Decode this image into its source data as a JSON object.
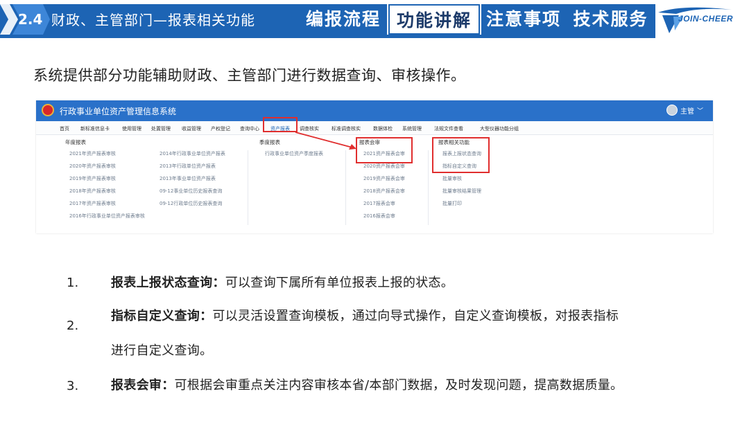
{
  "header": {
    "section_number": "2.4",
    "section_title": "财政、主管部门—报表相关功能",
    "tabs": [
      {
        "label": "编报流程",
        "active": false
      },
      {
        "label": "功能讲解",
        "active": true
      },
      {
        "label": "注意事项",
        "active": false
      },
      {
        "label": "技术服务",
        "active": false
      }
    ],
    "logo_text": "JOIN-CHEER",
    "brand_color": "#1d64b4"
  },
  "intro": "系统提供部分功能辅助财政、主管部门进行数据查询、审核操作。",
  "screenshot": {
    "system_title": "行政事业单位资产管理信息系统",
    "user_label": "主管",
    "user_chevron": "﹀",
    "menu_items": [
      "首页",
      "新标准信息卡",
      "使用管理",
      "处置管理",
      "收益管理",
      "产权登记",
      "查询中心",
      "资产报表",
      "调查核实",
      "标准调查核实",
      "数据体检",
      "系统管理",
      "法规文件查看",
      "大型仪器功能分组"
    ],
    "selected_menu": "资产报表",
    "columns": [
      {
        "heading": "年度报表",
        "items": [
          "2021年资产报表审核",
          "2020年资产报表审核",
          "2019年资产报表审核",
          "2018年资产报表审核",
          "2017年资产报表审核",
          "2016年行政事业单位资产报表审核"
        ]
      },
      {
        "heading": "",
        "items": [
          "2014年行政事业单位资产报表",
          "2013年行政单位资产报表",
          "2013年事业单位资产报表",
          "09-12事业单位历史报表查询",
          "09-12行政单位历史报表查询"
        ]
      },
      {
        "heading": "季度报表",
        "items": [
          "行政事业单位资产季度报表"
        ]
      },
      {
        "heading": "报表会审",
        "items": [
          "2021资产报表会审",
          "2020资产报表会审",
          "2019资产报表会审",
          "2018资产报表会审",
          "2017报表会审",
          "2016报表会审"
        ]
      },
      {
        "heading": "报表相关功能",
        "items": [
          "报表上报状态查询",
          "指标自定义查询",
          "批量审核",
          "批量审核结果管理",
          "批量打印"
        ]
      }
    ],
    "highlight_color": "#e02e2e"
  },
  "list": [
    {
      "number": "1.",
      "term": "报表上报状态查询：",
      "desc": "可以查询下属所有单位报表上报的状态。"
    },
    {
      "number": "2.",
      "term": "指标自定义查询：",
      "desc": "可以灵活设置查询模板，通过向导式操作，自定义查询模板，对报表指标",
      "desc2": "进行自定义查询。"
    },
    {
      "number": "3.",
      "term": "报表会审：",
      "desc": "可根据会审重点关注内容审核本省/本部门数据，及时发现问题，提高数据质量。"
    }
  ]
}
